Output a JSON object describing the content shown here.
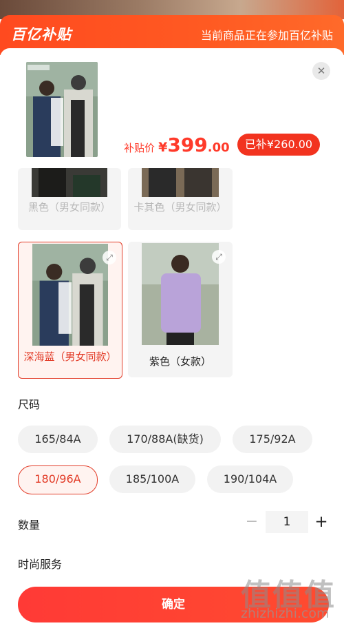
{
  "banner": {
    "logo": "百亿补贴",
    "notice": "当前商品正在参加百亿补贴"
  },
  "header": {
    "price_label": "补贴价",
    "currency": "¥",
    "price_int": "399",
    "price_dec": ".00",
    "subsidy": "已补¥260.00",
    "close_icon": "close-icon"
  },
  "variants": [
    {
      "label": "黑色（男女同款）",
      "state": "disabled"
    },
    {
      "label": "卡其色（男女同款）",
      "state": "disabled"
    },
    {
      "label": "深海蓝（男女同款）",
      "state": "selected"
    },
    {
      "label": "紫色（女款）",
      "state": "normal"
    }
  ],
  "size": {
    "title": "尺码",
    "options": [
      "165/84A",
      "170/88A(缺货)",
      "175/92A",
      "180/96A",
      "185/100A",
      "190/104A"
    ],
    "selected": "180/96A"
  },
  "quantity": {
    "title": "数量",
    "minus": "−",
    "value": "1",
    "plus": "+"
  },
  "service": {
    "title": "时尚服务"
  },
  "footer": {
    "confirm": "确定"
  },
  "watermark": {
    "logo": "值值值",
    "site": "zhizhizhi.com"
  },
  "colors": {
    "accent": "#e23a26",
    "banner": "#ff4a1f"
  }
}
